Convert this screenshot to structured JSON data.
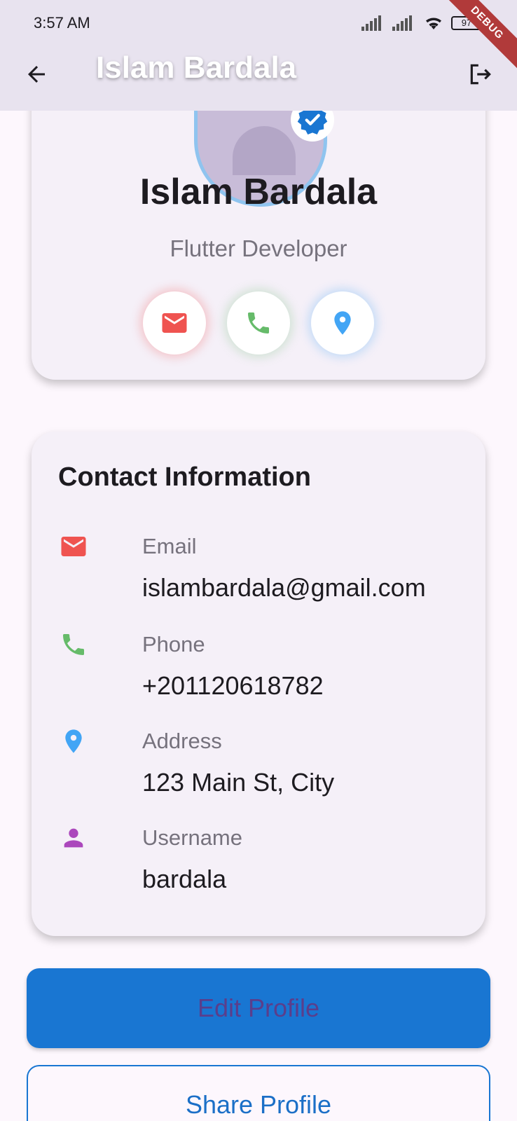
{
  "status_bar": {
    "time": "3:57 AM",
    "battery": "97",
    "debug_label": "DEBUG"
  },
  "app_bar": {
    "title": "Islam Bardala",
    "back_icon": "arrow-back-icon",
    "logout_icon": "logout-icon"
  },
  "profile": {
    "name": "Islam Bardala",
    "role": "Flutter Developer",
    "quick_actions": [
      {
        "icon": "email-icon",
        "color": "#ef5350"
      },
      {
        "icon": "phone-icon",
        "color": "#66bb6a"
      },
      {
        "icon": "location-icon",
        "color": "#42a5f5"
      }
    ]
  },
  "contact": {
    "title": "Contact Information",
    "rows": [
      {
        "label": "Email",
        "value": "islambardala@gmail.com",
        "icon": "email-icon",
        "color": "#ef5350"
      },
      {
        "label": "Phone",
        "value": "+201120618782",
        "icon": "phone-icon",
        "color": "#66bb6a"
      },
      {
        "label": "Address",
        "value": "123 Main St, City",
        "icon": "location-icon",
        "color": "#42a5f5"
      },
      {
        "label": "Username",
        "value": "bardala",
        "icon": "person-icon",
        "color": "#ab47bc"
      }
    ]
  },
  "buttons": {
    "edit": "Edit Profile",
    "share": "Share Profile"
  },
  "colors": {
    "primary": "#1976d2",
    "app_bar_bg": "#e8e3ef",
    "card_bg": "#f5f0f8",
    "page_bg": "#fdf7fd"
  }
}
